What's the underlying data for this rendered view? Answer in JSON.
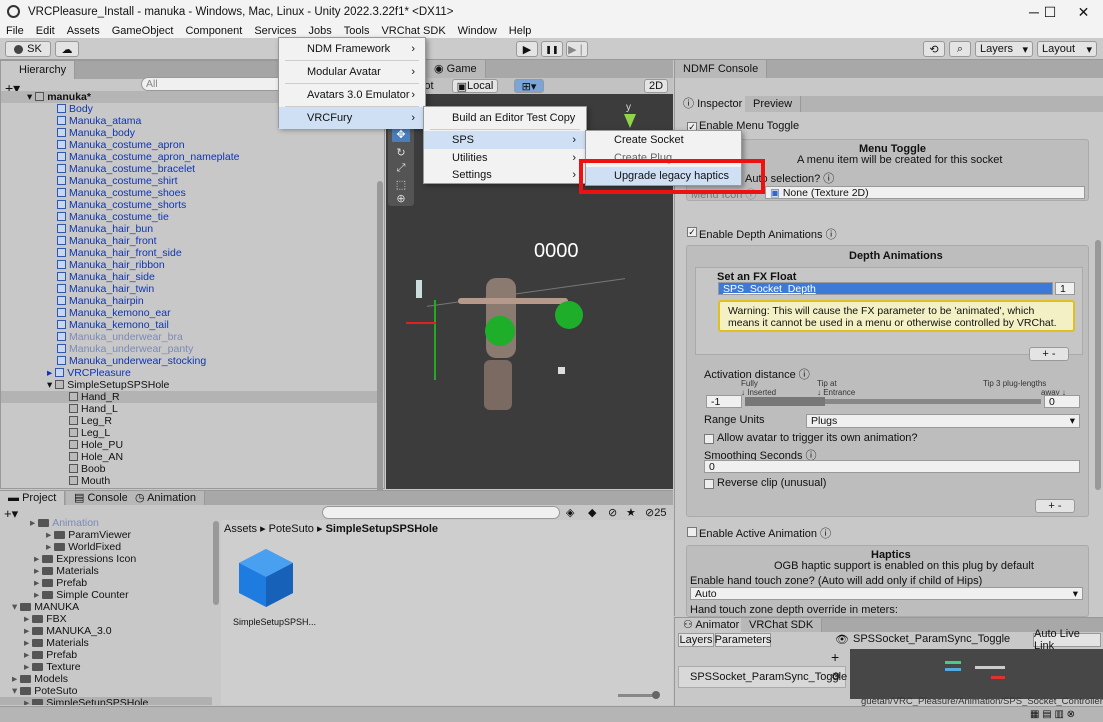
{
  "window": {
    "title": "VRCPleasure_Install - manuka - Windows, Mac, Linux - Unity 2022.3.22f1* <DX11>",
    "minimize": "─",
    "maximize": "☐",
    "close": "✕"
  },
  "menubar": [
    "File",
    "Edit",
    "Assets",
    "GameObject",
    "Component",
    "Services",
    "Jobs",
    "Tools",
    "VRChat SDK",
    "Window",
    "Help"
  ],
  "toolbar": {
    "account": "SK",
    "layers": "Layers",
    "layout": "Layout",
    "play": "▶",
    "pause": "❚❚",
    "step": "▶❘"
  },
  "hierarchy": {
    "tab": "Hierarchy",
    "search_placeholder": "All",
    "root": "manuka*",
    "items": [
      "Body",
      "Manuka_atama",
      "Manuka_body",
      "Manuka_costume_apron",
      "Manuka_costume_apron_nameplate",
      "Manuka_costume_bracelet",
      "Manuka_costume_shirt",
      "Manuka_costume_shoes",
      "Manuka_costume_shorts",
      "Manuka_costume_tie",
      "Manuka_hair_bun",
      "Manuka_hair_front",
      "Manuka_hair_front_side",
      "Manuka_hair_ribbon",
      "Manuka_hair_side",
      "Manuka_hair_twin",
      "Manuka_hairpin",
      "Manuka_kemono_ear",
      "Manuka_kemono_tail",
      "Manuka_underwear_bra",
      "Manuka_underwear_panty",
      "Manuka_underwear_stocking"
    ],
    "vrcpleasure": "VRCPleasure",
    "sps": "SimpleSetupSPSHole",
    "sps_children": [
      "Hand_R",
      "Hand_L",
      "Leg_R",
      "Leg_L",
      "Hole_PU",
      "Hole_AN",
      "Boob",
      "Mouth"
    ]
  },
  "tools_menu": [
    "NDM Framework",
    "Modular Avatar",
    "Avatars 3.0 Emulator",
    "VRCFury"
  ],
  "vrcfury_menu": [
    "Build an Editor Test Copy",
    "SPS",
    "Utilities",
    "Settings"
  ],
  "sps_menu": [
    "Create Socket",
    "Create Plug",
    "Upgrade legacy haptics"
  ],
  "scene": {
    "tab": "Game",
    "pivot": "ot",
    "local": "Local",
    "mode2d": "2D",
    "fps": "0000",
    "axis_y": "y"
  },
  "ndmf": {
    "tab": "NDMF Console"
  },
  "inspector": {
    "tabs": [
      "Inspector",
      "Preview"
    ],
    "menu_toggle_label": "Enable Menu Toggle",
    "menu_toggle_title": "Menu Toggle",
    "menu_toggle_desc": "A menu item will be created for this socket",
    "auto_selection": "Auto selection? ⓘ",
    "icon_label": "Menu Icon ⓘ",
    "icon_value": "None (Texture 2D)",
    "depth_label": "Enable Depth Animations ⓘ",
    "depth_title": "Depth Animations",
    "fx_float": "Set an FX Float",
    "param_value": "SPS_Socket_Depth",
    "param_num": "1",
    "warning": "Warning: This will cause the FX parameter to be 'animated', which means it cannot be used in a menu or otherwise controlled by VRChat.",
    "activation": "Activation distance ⓘ",
    "fully": "Fully",
    "inserted": "↓ Inserted",
    "tip_at": "Tip at",
    "entrance": "↓ Entrance",
    "tip3": "Tip 3 plug-lengths",
    "away": "away ↓",
    "act_min": "-1",
    "act_max": "0",
    "range_units": "Range Units",
    "range_value": "Plugs",
    "allow": "Allow avatar to trigger its own animation?",
    "smoothing": "Smoothing Seconds ⓘ",
    "smoothing_value": "0",
    "reverse": "Reverse clip (unusual)",
    "active_anim": "Enable Active Animation ⓘ",
    "haptics_title": "Haptics",
    "haptics_desc": "OGB haptic support is enabled on this plug by default",
    "hand_touch": "Enable hand touch zone? (Auto will add only if child of Hips)",
    "hand_value": "Auto",
    "hand_depth": "Hand touch zone depth override in meters:",
    "plusminus": "+ -"
  },
  "animator": {
    "tabs": [
      "Animator",
      "VRChat SDK"
    ],
    "subtabs": [
      "Layers",
      "Parameters"
    ],
    "crumb": "SPSSocket_ParamSync_Toggle",
    "autolive": "Auto Live Link",
    "layer": "SPSSocket_ParamSync_Toggle",
    "path": "guetan/VRC_Pleasure/Animation/SPS_Socket_Controller.controller"
  },
  "project": {
    "tabs": [
      "Project",
      "Console",
      "Animation"
    ],
    "count": "25",
    "tree": [
      [
        "Animation",
        "dim",
        40
      ],
      [
        "ParamViewer",
        "f",
        56
      ],
      [
        "WorldFixed",
        "f",
        56
      ],
      [
        "Expressions Icon",
        "f",
        44
      ],
      [
        "Materials",
        "f",
        44
      ],
      [
        "Prefab",
        "f",
        44
      ],
      [
        "Simple Counter",
        "f",
        44
      ],
      [
        "MANUKA",
        "f",
        22
      ],
      [
        "FBX",
        "f",
        34
      ],
      [
        "MANUKA_3.0",
        "f",
        34
      ],
      [
        "Materials",
        "f",
        34
      ],
      [
        "Prefab",
        "f",
        34
      ],
      [
        "Texture",
        "f",
        34
      ],
      [
        "Models",
        "f",
        22
      ],
      [
        "PoteSuto",
        "f",
        22
      ],
      [
        "SimpleSetupSPSHole",
        "f",
        34
      ]
    ],
    "breadcrumb": [
      "Assets",
      "PoteSuto",
      "SimpleSetupSPSHole"
    ],
    "asset": "SimpleSetupSPSH..."
  }
}
